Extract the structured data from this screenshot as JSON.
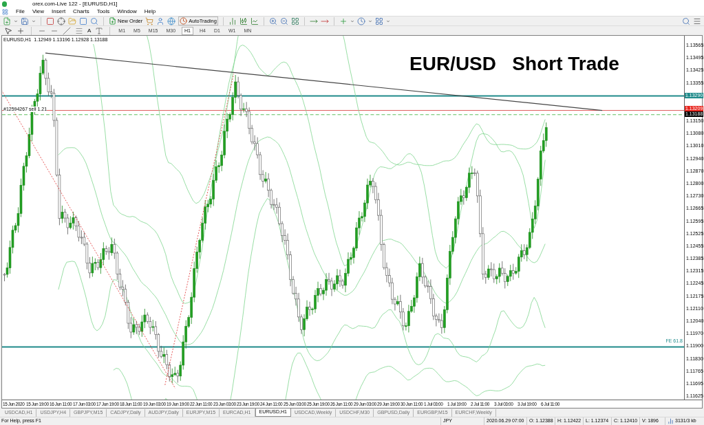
{
  "window": {
    "title": "orex.com-Live 122 - [EURUSD,H1]"
  },
  "menu": [
    "File",
    "View",
    "Insert",
    "Charts",
    "Tools",
    "Window",
    "Help"
  ],
  "toolbar": {
    "new_order": "New Order",
    "autotrading": "AutoTrading",
    "text_tool": "A"
  },
  "timeframes": [
    {
      "label": "M1",
      "selected": false
    },
    {
      "label": "M5",
      "selected": false
    },
    {
      "label": "M15",
      "selected": false
    },
    {
      "label": "M30",
      "selected": false
    },
    {
      "label": "H1",
      "selected": true
    },
    {
      "label": "H4",
      "selected": false
    },
    {
      "label": "D1",
      "selected": false
    },
    {
      "label": "W1",
      "selected": false
    },
    {
      "label": "MN",
      "selected": false
    }
  ],
  "chart": {
    "header": "EURUSD,H1  1.12949 1.13196 1.12928 1.13188",
    "title": "EUR/USD   Short Trade",
    "order_label": "#12594267 sell 1.21",
    "fib_label": "FE 61.8",
    "price_ticks_upper": [
      "1.13565",
      "1.13495",
      "1.13425",
      "1.13355"
    ],
    "price_ticks_lower": [
      "1.13150",
      "1.13080",
      "1.13010",
      "1.12940",
      "1.12870",
      "1.12800",
      "1.12730",
      "1.12665",
      "1.12595",
      "1.12525",
      "1.12455",
      "1.12385",
      "1.12315",
      "1.12245",
      "1.12175",
      "1.12110",
      "1.12040",
      "1.11970",
      "1.11900",
      "1.11830",
      "1.11765",
      "1.11695",
      "1.11625"
    ],
    "price_markers": [
      {
        "text": "1.13290",
        "color": "#1e8a8a"
      },
      {
        "text": "1.13209",
        "color": "#e8231c"
      },
      {
        "text": "1.13188",
        "color": "#000000"
      }
    ],
    "time_ticks": [
      "15 Jun 2020",
      "15 Jun 19:00",
      "16 Jun 11:00",
      "17 Jun 03:00",
      "17 Jun 19:00",
      "18 Jun 11:00",
      "19 Jun 03:00",
      "19 Jun 19:00",
      "22 Jun 11:00",
      "23 Jun 03:00",
      "23 Jun 19:00",
      "24 Jun 11:00",
      "25 Jun 03:00",
      "25 Jun 19:00",
      "26 Jun 11:00",
      "29 Jun 03:00",
      "29 Jun 19:00",
      "30 Jun 11:00",
      "1 Jul 03:00",
      "1 Jul 19:00",
      "2 Jul 11:00",
      "3 Jul 03:00",
      "3 Jul 19:00",
      "6 Jul 11:00"
    ]
  },
  "tabs": [
    {
      "label": "USDCAD,H1",
      "selected": false
    },
    {
      "label": "USDJPY,H4",
      "selected": false
    },
    {
      "label": "GBPJPY,M15",
      "selected": false
    },
    {
      "label": "CADJPY,Daily",
      "selected": false
    },
    {
      "label": "AUDJPY,Daily",
      "selected": false
    },
    {
      "label": "EURJPY,M15",
      "selected": false
    },
    {
      "label": "EURCAD,H1",
      "selected": false
    },
    {
      "label": "EURUSD,H1",
      "selected": true
    },
    {
      "label": "USDCAD,Weekly",
      "selected": false
    },
    {
      "label": "USDCHF,M30",
      "selected": false
    },
    {
      "label": "GBPUSD,Daily",
      "selected": false
    },
    {
      "label": "EURGBP,M15",
      "selected": false
    },
    {
      "label": "EURCHF,Weekly",
      "selected": false
    }
  ],
  "status_bar": {
    "help": "For Help, press F1",
    "currency": "JPY",
    "time": "2020.06.29 07:00",
    "open": "O: 1.12388",
    "high": "H: 1.12422",
    "low": "L: 1.12374",
    "close": "C: 1.12410",
    "volume": "V: 1896",
    "traffic": "3131/3 kb"
  }
}
